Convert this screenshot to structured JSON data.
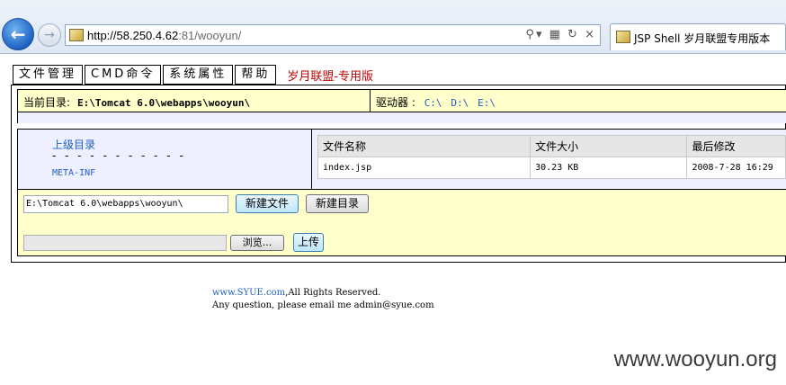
{
  "browser": {
    "url_dark": "http://58.250.4.62",
    "url_light": ":81/wooyun/",
    "tab_title": "JSP Shell 岁月联盟专用版本"
  },
  "nav": {
    "file_manager": "文件管理",
    "cmd": "CMD命令",
    "sys_props": "系统属性",
    "help": "帮助",
    "brand": "岁月联盟-专用版"
  },
  "dir": {
    "current_label": "当前目录:",
    "current_path": "E:\\Tomcat 6.0\\webapps\\wooyun\\",
    "drives_label": "驱动器 :",
    "drives": [
      "C:\\",
      "D:\\",
      "E:\\"
    ]
  },
  "tree": {
    "parent": "上级目录",
    "dashes": "- - - - - - - - - - -",
    "subdirs": [
      "META-INF"
    ]
  },
  "files": {
    "headers": [
      "文件名称",
      "文件大小",
      "最后修改"
    ],
    "rows": [
      {
        "name": "index.jsp",
        "size": "30.23 KB",
        "modified": "2008-7-28 16:29"
      }
    ]
  },
  "actions": {
    "path_value": "E:\\Tomcat 6.0\\webapps\\wooyun\\",
    "new_file": "新建文件",
    "new_dir": "新建目录",
    "browse": "浏览...",
    "upload": "上传"
  },
  "footer": {
    "site": "www.SYUE.com",
    "rights": ",All Rights Reserved.",
    "contact": "Any question, please email me admin@syue.com"
  },
  "watermark": "www.wooyun.org"
}
